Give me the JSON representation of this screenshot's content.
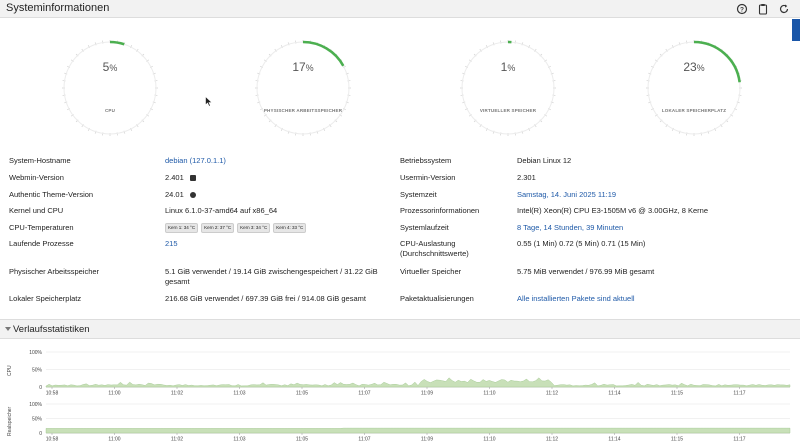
{
  "header": {
    "title": "Systeminformationen",
    "icons": [
      "help-icon",
      "clipboard-icon",
      "refresh-icon"
    ]
  },
  "gauges": [
    {
      "value": "5",
      "unit": "%",
      "label": "CPU",
      "fraction": 0.05
    },
    {
      "value": "17",
      "unit": "%",
      "label": "PHYSISCHER ARBEITSSPEICHER",
      "fraction": 0.17
    },
    {
      "value": "1",
      "unit": "%",
      "label": "VIRTUELLER SPEICHER",
      "fraction": 0.01
    },
    {
      "value": "23",
      "unit": "%",
      "label": "LOKALER SPEICHERPLATZ",
      "fraction": 0.23
    }
  ],
  "info_left": [
    {
      "label": "System-Hostname",
      "value": "debian (127.0.1.1)",
      "link": true
    },
    {
      "label": "Webmin-Version",
      "value": "2.401",
      "icon": "package-icon"
    },
    {
      "label": "Authentic Theme-Version",
      "value": "24.01",
      "icon": "palette-icon"
    },
    {
      "label": "Kernel und CPU",
      "value": "Linux 6.1.0-37-amd64 auf x86_64"
    },
    {
      "label": "CPU-Temperaturen",
      "badges": [
        "Kern 1: 34 °C",
        "Kern 2: 37 °C",
        "Kern 3: 34 °C",
        "Kern 4: 33 °C"
      ]
    },
    {
      "label": "Laufende Prozesse",
      "value": "215",
      "link": true
    },
    {
      "label": "Physischer Arbeitsspeicher",
      "value": "5.1 GiB verwendet / 19.14 GiB zwischengespeichert / 31.22 GiB gesamt"
    },
    {
      "label": "Lokaler Speicherplatz",
      "value": "216.68 GiB verwendet / 697.39 GiB frei / 914.08 GiB gesamt"
    }
  ],
  "info_right": [
    {
      "label": "Betriebssystem",
      "value": "Debian Linux 12"
    },
    {
      "label": "Usermin-Version",
      "value": "2.301"
    },
    {
      "label": "Systemzeit",
      "value": "Samstag, 14. Juni 2025 11:19",
      "link": true
    },
    {
      "label": "Prozessorinformationen",
      "value": "Intel(R) Xeon(R) CPU E3-1505M v6 @ 3.00GHz, 8 Kerne"
    },
    {
      "label": "Systemlaufzeit",
      "value": "8 Tage, 14 Stunden, 39 Minuten",
      "link": true
    },
    {
      "label": "CPU-Auslastung (Durchschnittswerte)",
      "value": "0.55 (1 Min) 0.72 (5 Min) 0.71 (15 Min)"
    },
    {
      "label": "Virtueller Speicher",
      "value": "5.75 MiB verwendet / 976.99 MiB gesamt"
    },
    {
      "label": "Paketaktualisierungen",
      "value": "Alle installierten Pakete sind aktuell",
      "link": true
    }
  ],
  "history": {
    "title": "Verlaufsstatistiken",
    "graphs": [
      {
        "ylabel": "CPU",
        "yticks": [
          "100%",
          "50%",
          "0"
        ]
      },
      {
        "ylabel": "Realspeicher",
        "yticks": [
          "100%",
          "50%",
          "0"
        ]
      }
    ],
    "xticks": [
      "10:58",
      "11:00",
      "11:02",
      "11:03",
      "11:05",
      "11:07",
      "11:09",
      "11:10",
      "11:12",
      "11:14",
      "11:15",
      "11:17"
    ]
  },
  "colors": {
    "accent": "#4caf50",
    "link": "#1f5aa8",
    "fill": "#c8e0b8"
  }
}
